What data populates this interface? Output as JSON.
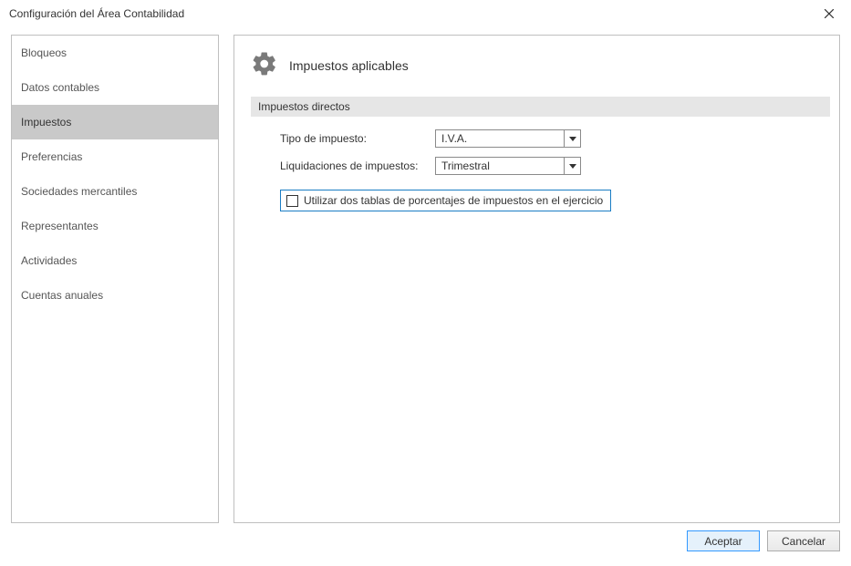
{
  "window": {
    "title": "Configuración del Área Contabilidad"
  },
  "sidebar": {
    "items": [
      {
        "label": "Bloqueos",
        "id": "bloqueos"
      },
      {
        "label": "Datos contables",
        "id": "datos-contables"
      },
      {
        "label": "Impuestos",
        "id": "impuestos"
      },
      {
        "label": "Preferencias",
        "id": "preferencias"
      },
      {
        "label": "Sociedades mercantiles",
        "id": "sociedades-mercantiles"
      },
      {
        "label": "Representantes",
        "id": "representantes"
      },
      {
        "label": "Actividades",
        "id": "actividades"
      },
      {
        "label": "Cuentas anuales",
        "id": "cuentas-anuales"
      }
    ],
    "activeIndex": 2
  },
  "panel": {
    "title": "Impuestos aplicables",
    "section_header": "Impuestos directos",
    "tipo_label": "Tipo de impuesto:",
    "tipo_value": "I.V.A.",
    "liquidaciones_label": "Liquidaciones de impuestos:",
    "liquidaciones_value": "Trimestral",
    "checkbox_label": "Utilizar dos tablas de porcentajes de impuestos en el ejercicio",
    "checkbox_checked": false
  },
  "buttons": {
    "accept": "Aceptar",
    "cancel": "Cancelar"
  }
}
